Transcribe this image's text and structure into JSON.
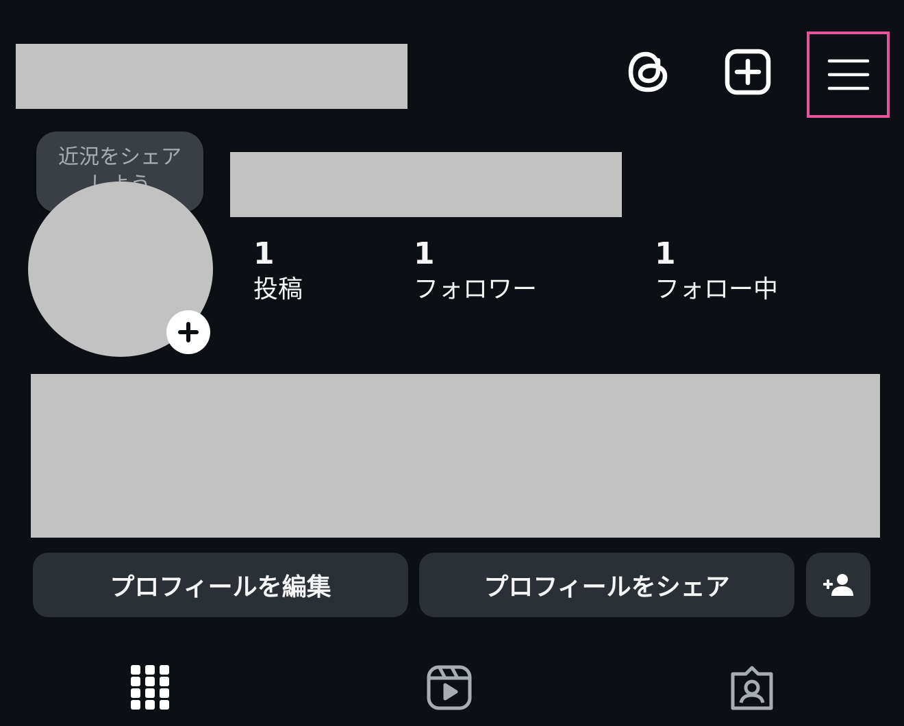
{
  "header": {
    "icons": [
      "threads-icon",
      "new-post-icon",
      "hamburger-menu-icon"
    ],
    "highlight_color": "#e4559c"
  },
  "profile": {
    "note": "近況をシェア\nしよう",
    "avatar_add_icon": "plus-icon",
    "stats": {
      "posts": {
        "value": "1",
        "label": "投稿"
      },
      "followers": {
        "value": "1",
        "label": "フォロワー"
      },
      "following": {
        "value": "1",
        "label": "フォロー中"
      }
    }
  },
  "actions": {
    "edit_profile": "プロフィールを編集",
    "share_profile": "プロフィールをシェア",
    "discover_icon": "add-person-icon"
  },
  "tabs": [
    "grid-icon",
    "reels-icon",
    "tagged-icon"
  ],
  "colors": {
    "background": "#0c1014",
    "button_bg": "#2b3036",
    "redaction": "#c2c2c2"
  }
}
